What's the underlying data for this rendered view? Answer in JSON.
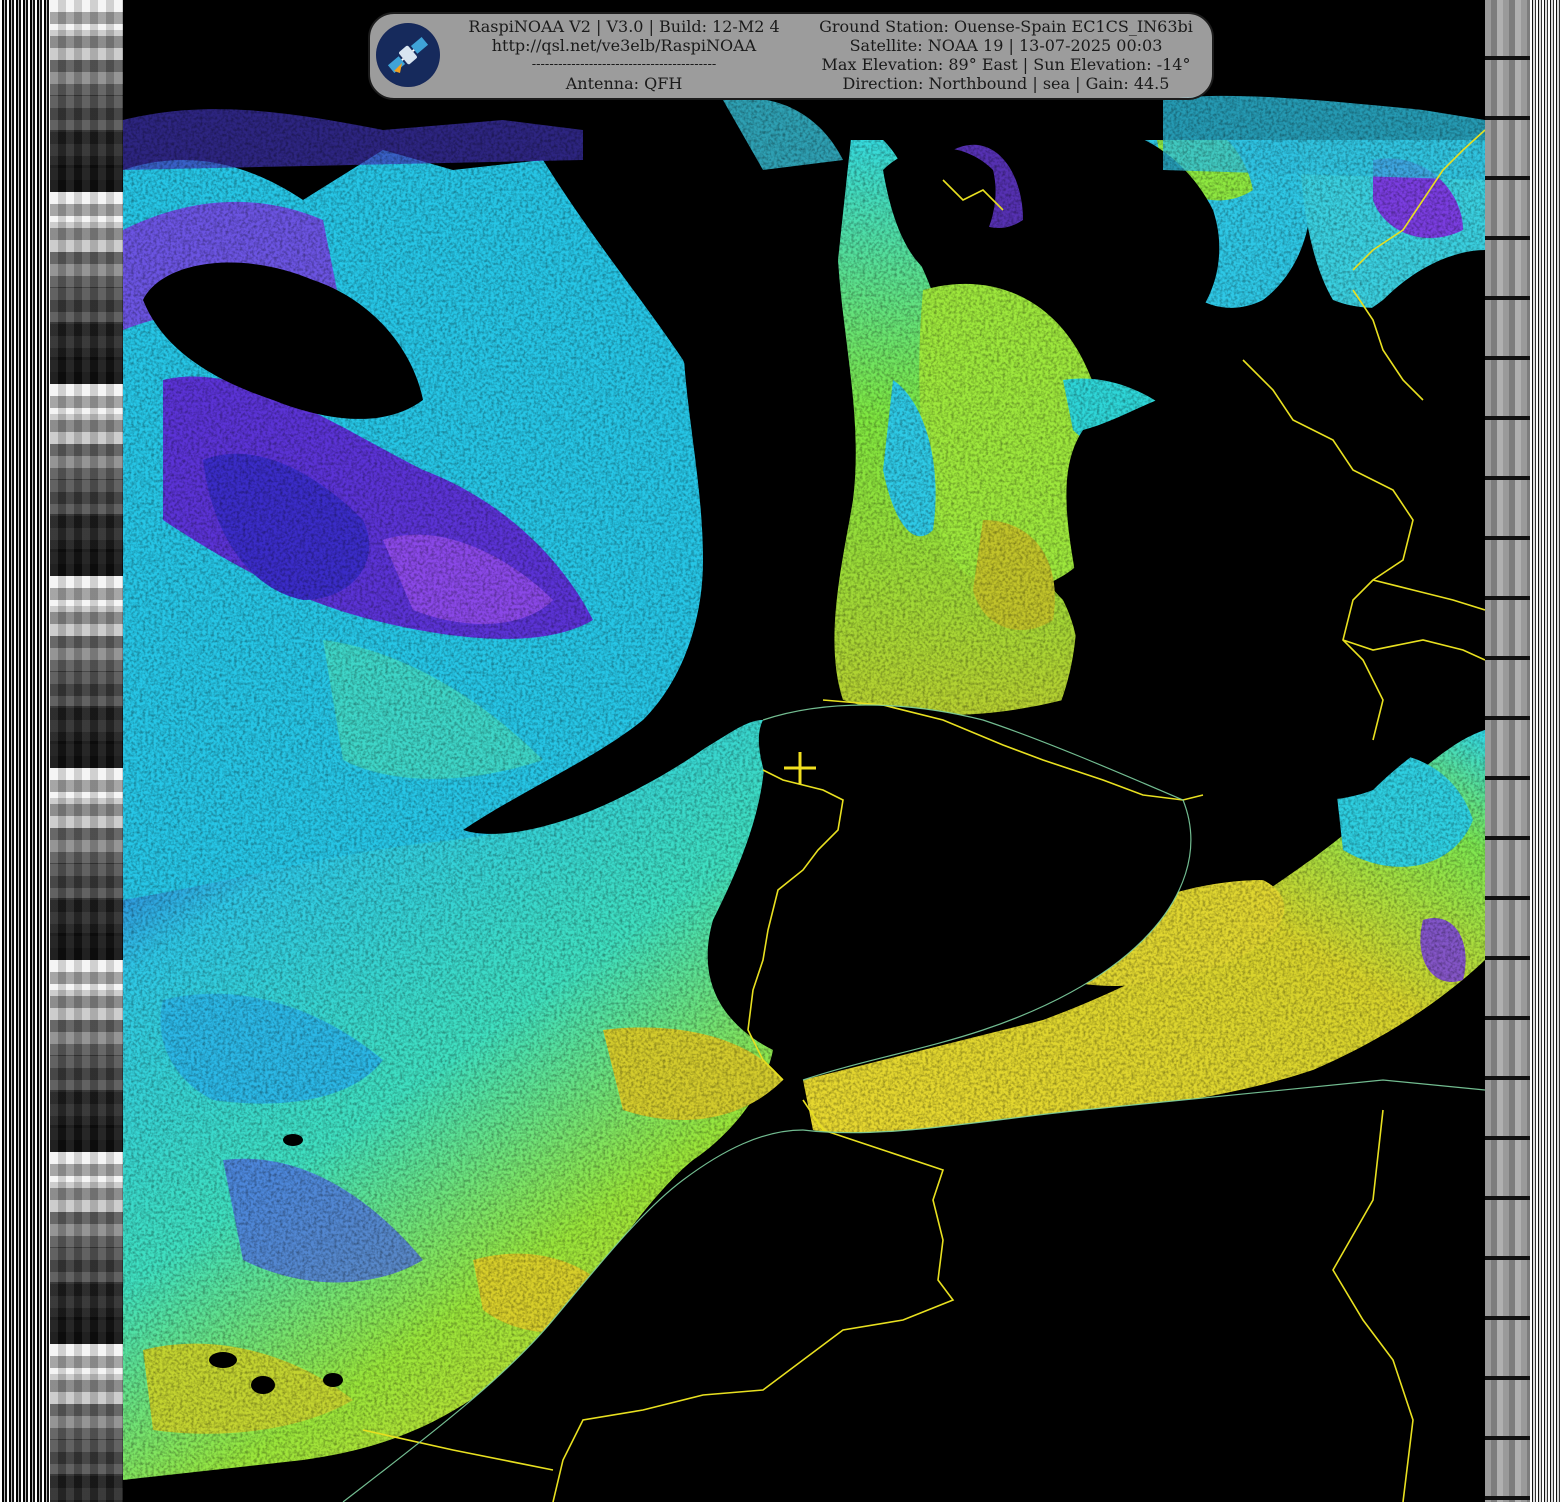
{
  "banner": {
    "line1": "RaspiNOAA V2 | V3.0 | Build: 12-M2 4",
    "line2": "http://qsl.net/ve3elb/RaspiNOAA",
    "divider": "------------------------------------------",
    "line4": "Antenna: QFH",
    "station": "Ground Station: Ouense-Spain EC1CS_IN63bi",
    "satellite": "Satellite: NOAA 19 | 13-07-2025 00:03",
    "elevation": "Max Elevation: 89° East | Sun Elevation: -14°",
    "direction": "Direction: Northbound | sea | Gain: 44.5"
  },
  "colors": {
    "border_line": "#e8e020",
    "cloud_cyan": "#2ee6e0",
    "cloud_green": "#8ee840",
    "cloud_yellow": "#e4dc30",
    "cloud_purple": "#8040e0",
    "cloud_blue": "#3a3ad8"
  }
}
